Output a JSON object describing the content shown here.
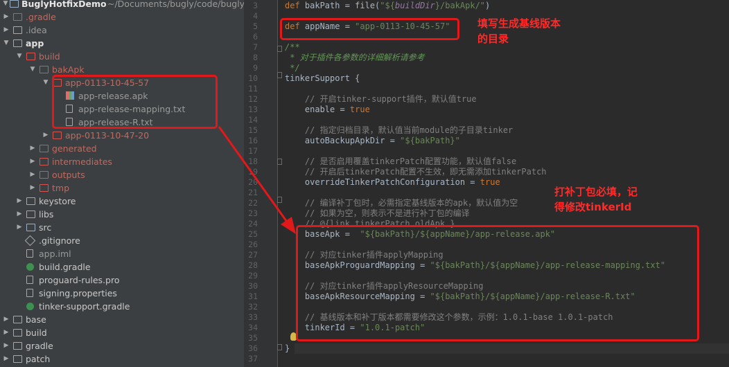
{
  "project_tree": {
    "root": {
      "name": "BuglyHotfixDemo",
      "path": "~/Documents/bugly/code/bugly-"
    },
    "items": [
      {
        "label": ".gradle",
        "color": "red"
      },
      {
        "label": ".idea",
        "color": "grey"
      },
      {
        "label": "app",
        "color": "white"
      },
      {
        "label": "build",
        "color": "red"
      },
      {
        "label": "bakApk",
        "color": "red"
      },
      {
        "label": "app-0113-10-45-57",
        "color": "red"
      },
      {
        "label": "app-release.apk",
        "color": "grey"
      },
      {
        "label": "app-release-mapping.txt",
        "color": "grey"
      },
      {
        "label": "app-release-R.txt",
        "color": "grey"
      },
      {
        "label": "app-0113-10-47-20",
        "color": "red"
      },
      {
        "label": "generated",
        "color": "red"
      },
      {
        "label": "intermediates",
        "color": "red"
      },
      {
        "label": "outputs",
        "color": "red"
      },
      {
        "label": "tmp",
        "color": "red"
      },
      {
        "label": "keystore",
        "color": "white"
      },
      {
        "label": "libs",
        "color": "white"
      },
      {
        "label": "src",
        "color": "white"
      },
      {
        "label": ".gitignore",
        "color": "white"
      },
      {
        "label": "app.iml",
        "color": "grey"
      },
      {
        "label": "build.gradle",
        "color": "white"
      },
      {
        "label": "proguard-rules.pro",
        "color": "white"
      },
      {
        "label": "signing.properties",
        "color": "white"
      },
      {
        "label": "tinker-support.gradle",
        "color": "white"
      },
      {
        "label": "base",
        "color": "white"
      },
      {
        "label": "build",
        "color": "white"
      },
      {
        "label": "gradle",
        "color": "white"
      },
      {
        "label": "patch",
        "color": "white"
      }
    ]
  },
  "editor": {
    "line_numbers": [
      "3",
      "4",
      "5",
      "6",
      "7",
      "8",
      "9",
      "10",
      "11",
      "12",
      "13",
      "14",
      "15",
      "16",
      "17",
      "18",
      "19",
      "20",
      "21",
      "22",
      "23",
      "24",
      "25",
      "26",
      "27",
      "28",
      "29",
      "30",
      "31",
      "32",
      "33",
      "34",
      "35",
      "36",
      "37"
    ],
    "lines": {
      "l3": {
        "kw": "def",
        "rest1": " bakPath = file(",
        "str_open": "\"${",
        "var": "buildDir",
        "str_close": "}/bakApk/\"",
        ")": ")"
      },
      "l5": {
        "kw": "def",
        "rest": " appName = ",
        "str": "\"app-0113-10-45-57\""
      },
      "l7": "/**",
      "l8": " * 对于插件各参数的详细解析请参考",
      "l9": " */",
      "l10": "tinkerSupport {",
      "l12": "    // 开启tinker-support插件，默认值true",
      "l13": {
        "name": "    enable = ",
        "val": "true"
      },
      "l15": "    // 指定归档目录，默认值当前module的子目录tinker",
      "l16": {
        "name": "    autoBackupApkDir = ",
        "str": "\"${bakPath}\""
      },
      "l18": "    // 是否启用覆盖tinkerPatch配置功能，默认值false",
      "l19": "    // 开启后tinkerPatch配置不生效，即无需添加tinkerPatch",
      "l20": {
        "name": "    overrideTinkerPatchConfiguration = ",
        "val": "true"
      },
      "l22": "    // 编译补丁包时，必需指定基线版本的apk，默认值为空",
      "l23": "    // 如果为空，则表示不是进行补丁包的编译",
      "l24": "    // @{link tinkerPatch.oldApk }",
      "l25": {
        "name": "    baseApk =  ",
        "a": "\"${bakPath}/${appName}",
        "b": "/app-release.apk\""
      },
      "l27": "    // 对应tinker插件applyMapping",
      "l28": {
        "name": "    baseApkProguardMapping = ",
        "a": "\"${bakPath}/${appName}",
        "b": "/app-release-mapping.txt\""
      },
      "l30": "    // 对应tinker插件applyResourceMapping",
      "l31": {
        "name": "    baseApkResourceMapping = ",
        "a": "\"${bakPath}/${appName}",
        "b": "/app-release-R.txt\""
      },
      "l33": "    // 基线版本和补丁版本都需要修改这个参数，示例：1.0.1-base 1.0.1-patch",
      "l34": {
        "name": "    tinkerId = ",
        "str": "\"1.0.1-patch\""
      },
      "l36": "}"
    }
  },
  "annotations": {
    "note1": [
      "填写生成基线版本",
      "的目录"
    ],
    "note2": [
      "打补丁包必填，记",
      "得修改tinkerId"
    ]
  },
  "colors": {
    "annotation_red": "#e1191b",
    "keyword": "#cc7832",
    "string": "#6a8759",
    "comment": "#808080"
  }
}
